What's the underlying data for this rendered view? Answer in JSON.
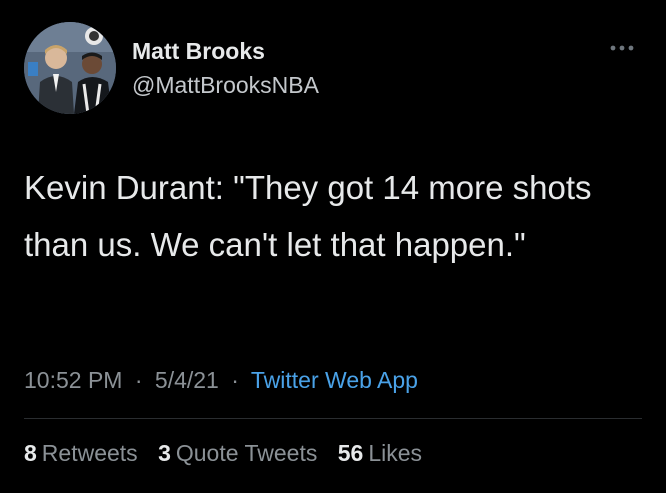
{
  "author": {
    "name": "Matt Brooks",
    "handle": "@MattBrooksNBA",
    "avatar_icon": "profile-photo"
  },
  "more_icon": "more-horizontal-icon",
  "tweet": {
    "text": "Kevin Durant: \"They got 14 more shots than us. We can't let that happen.\"",
    "time": "10:52 PM",
    "separator": "·",
    "date": "5/4/21",
    "source": "Twitter Web App"
  },
  "stats": {
    "retweets_count": "8",
    "retweets_label": "Retweets",
    "quote_count": "3",
    "quote_label": "Quote Tweets",
    "likes_count": "56",
    "likes_label": "Likes"
  },
  "colors": {
    "background": "#000000",
    "text": "#e7e9ea",
    "secondary": "#8b9196",
    "link": "#4aa2e8",
    "divider": "#2a2d30"
  }
}
